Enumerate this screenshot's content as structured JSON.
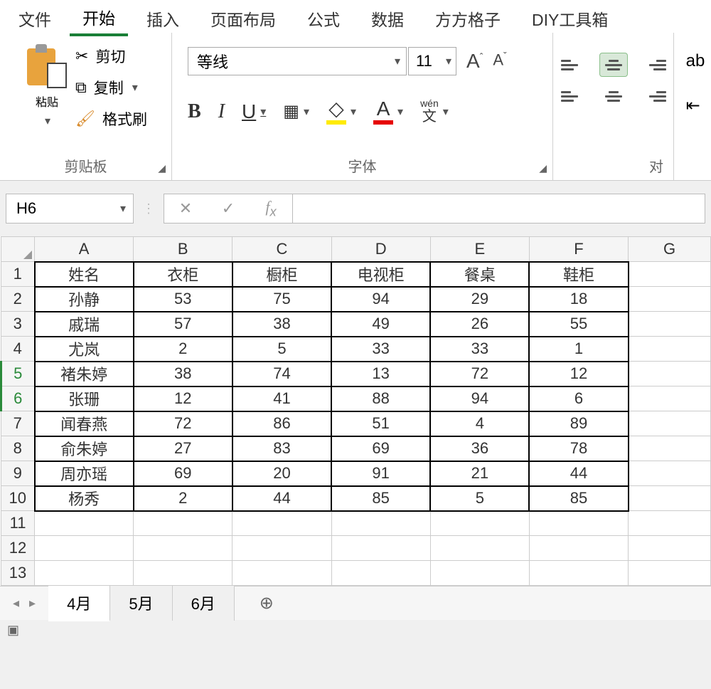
{
  "menu": {
    "items": [
      "文件",
      "开始",
      "插入",
      "页面布局",
      "公式",
      "数据",
      "方方格子",
      "DIY工具箱"
    ],
    "active_index": 1
  },
  "ribbon": {
    "clipboard": {
      "paste": "粘贴",
      "cut": "剪切",
      "copy": "复制",
      "format_painter": "格式刷",
      "group_label": "剪贴板"
    },
    "font": {
      "name": "等线",
      "size": "11",
      "grow": "A",
      "shrink": "A",
      "bold": "B",
      "italic": "I",
      "underline": "U",
      "pinyin_top": "wén",
      "pinyin_bot": "文",
      "group_label": "字体"
    },
    "alignment": {
      "group_label": "对"
    }
  },
  "namebox": "H6",
  "formula": "",
  "columns": [
    "A",
    "B",
    "C",
    "D",
    "E",
    "F",
    "G"
  ],
  "chart_data": {
    "type": "table",
    "headers": [
      "姓名",
      "衣柜",
      "橱柜",
      "电视柜",
      "餐桌",
      "鞋柜"
    ],
    "rows": [
      [
        "孙静",
        53,
        75,
        94,
        29,
        18
      ],
      [
        "戚瑞",
        57,
        38,
        49,
        26,
        55
      ],
      [
        "尤岚",
        2,
        5,
        33,
        33,
        1
      ],
      [
        "褚朱婷",
        38,
        74,
        13,
        72,
        12
      ],
      [
        "张珊",
        12,
        41,
        88,
        94,
        6
      ],
      [
        "闻春燕",
        72,
        86,
        51,
        4,
        89
      ],
      [
        "俞朱婷",
        27,
        83,
        69,
        36,
        78
      ],
      [
        "周亦瑶",
        69,
        20,
        91,
        21,
        44
      ],
      [
        "杨秀",
        2,
        44,
        85,
        5,
        85
      ]
    ]
  },
  "selected_rows": [
    5,
    6
  ],
  "total_rows": 13,
  "sheet_tabs": {
    "items": [
      "4月",
      "5月",
      "6月"
    ],
    "active_index": 0
  }
}
